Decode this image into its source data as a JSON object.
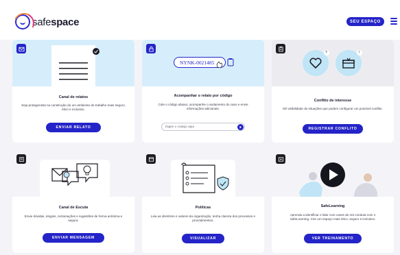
{
  "header": {
    "logo_text": "safe",
    "logo_text_light": "space",
    "seu_espaco_label": "SEU ESPAÇO",
    "menu_icon": "hamburger-icon"
  },
  "cards": [
    {
      "title": "Canal de relatos",
      "description": "Seja protagonista na construção de um ambiente de trabalho mais seguro, ético e inclusivo.",
      "button": "ENVIAR RELATO",
      "icon": "mail-icon"
    },
    {
      "title": "Acompanhar o relato por código",
      "description": "Cole o código abaixo, acompanhe o andamento do caso e envie informações adicionais.",
      "code_example": "NYNK-0021485",
      "input_placeholder": "Digite o código aqui",
      "icon": "lock-icon"
    },
    {
      "title": "Conflito de interesse",
      "description": "Dê visibilidade de situações que podem configurar um possível conflito.",
      "button": "REGISTRAR CONFLITO",
      "icon": "clipboard-icon",
      "illustration_marks": [
        "?",
        "!"
      ]
    },
    {
      "title": "Canal de Escuta",
      "description": "Envie dúvidas, elogios, reclamações e sugestões de forma anônima e segura.",
      "button": "ENVIAR MENSAGEM",
      "icon": "list-icon"
    },
    {
      "title": "Políticas",
      "description": "Leia as diretrizes e valores da organização, tenha clareza dos processos e procedimentos.",
      "button": "VISUALIZAR",
      "icon": "window-icon"
    },
    {
      "title": "SafeLearning",
      "description": "Aprenda a identificar e lidar com casos de má conduta com o SafeLearning. Crie um espaço mais ético, seguro e inclusivo.",
      "button": "VER TREINAMENTO",
      "icon": "video-icon"
    }
  ],
  "colors": {
    "primary": "#2424c8",
    "light_blue": "#d6eefb",
    "dark": "#1c1c24",
    "background": "#f4f4f8"
  }
}
